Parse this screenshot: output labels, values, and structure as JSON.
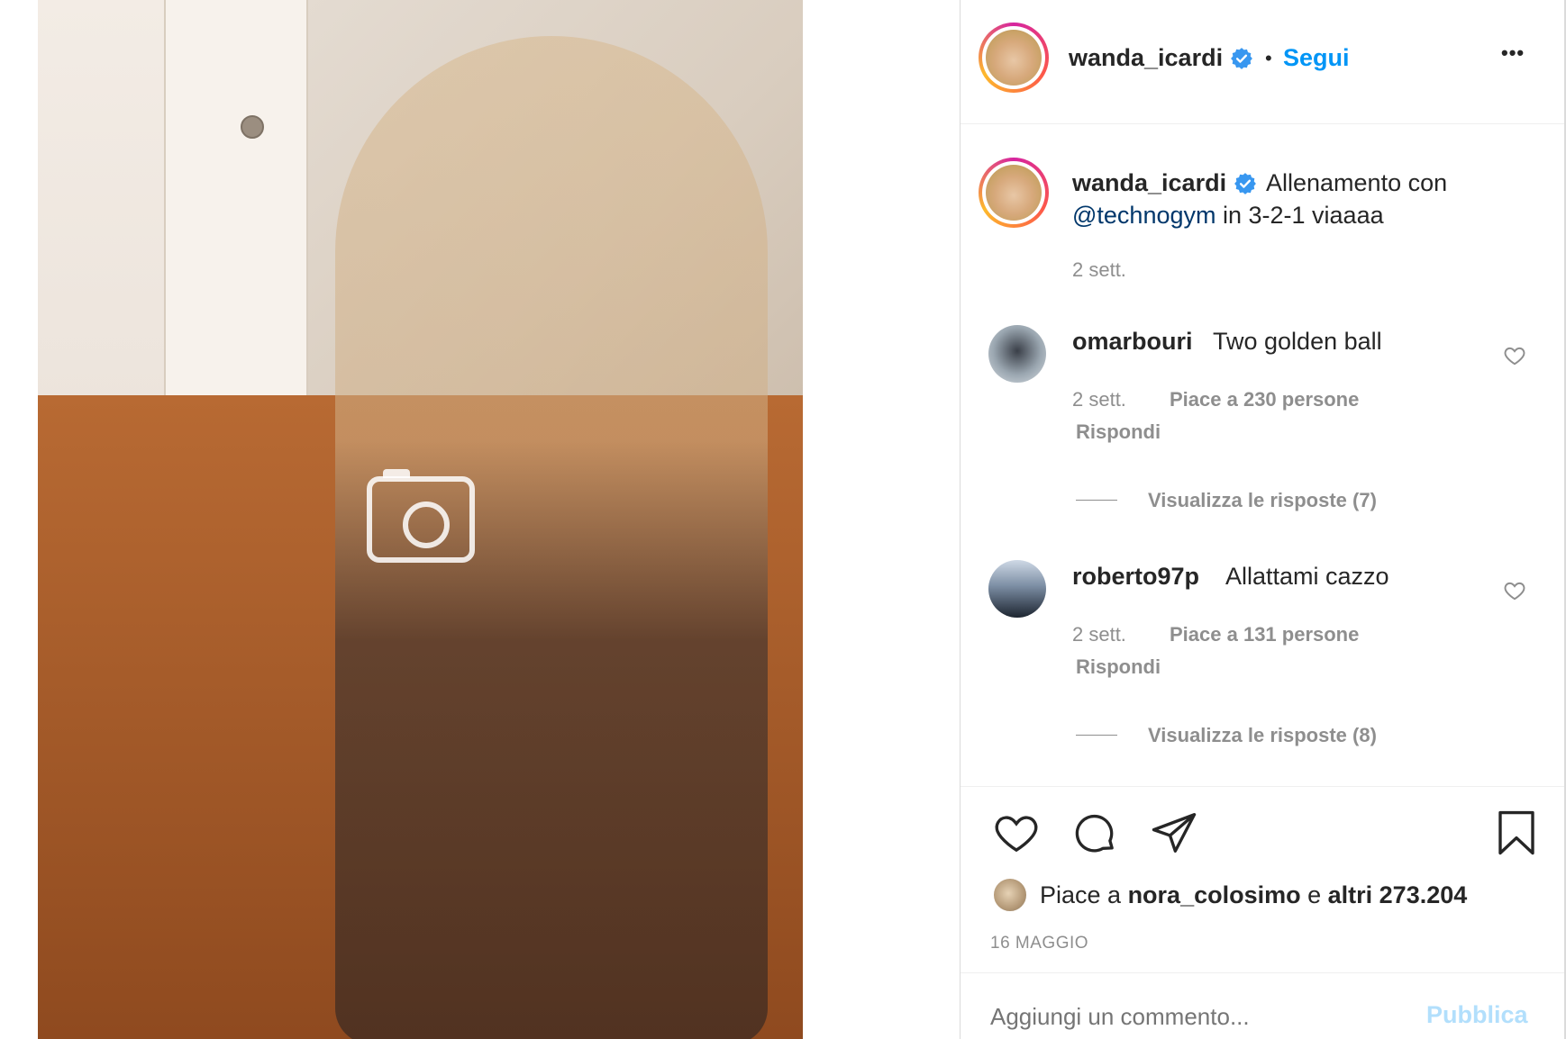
{
  "post": {
    "image_alt": "Post photo"
  },
  "header": {
    "username": "wanda_icardi",
    "separator": "•",
    "follow_label": "Segui",
    "more_label": "•••"
  },
  "caption": {
    "username": "wanda_icardi",
    "text_before": "Allenamento con",
    "mention": "@technogym",
    "text_after": " in 3-2-1 viaaaa",
    "time": "2 sett."
  },
  "comments": [
    {
      "username": "omarbouri",
      "text": "Two golden ball",
      "time": "2 sett.",
      "likes": "Piace a 230 persone",
      "reply": "Rispondi",
      "view_replies": "Visualizza le risposte (7)"
    },
    {
      "username": "roberto97p",
      "text": "Allattami cazzo",
      "time": "2 sett.",
      "likes": "Piace a 131 persone",
      "reply": "Rispondi",
      "view_replies": "Visualizza le risposte (8)"
    }
  ],
  "likes": {
    "prefix": "Piace a ",
    "user": "nora_colosimo",
    "middle": " e ",
    "others": "altri 273.204"
  },
  "date": "16 MAGGIO",
  "comment_box": {
    "placeholder": "Aggiungi un commento...",
    "publish": "Pubblica"
  },
  "colors": {
    "accent": "#0095f6",
    "publish_disabled": "#b2dffc",
    "verified": "#3897f0",
    "mention": "#00376b"
  }
}
